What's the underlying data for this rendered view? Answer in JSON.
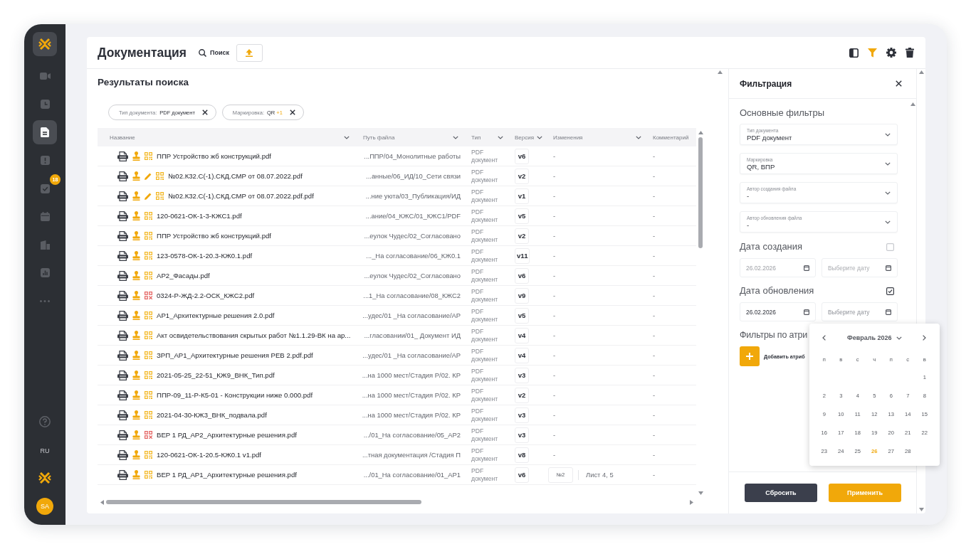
{
  "sidebar": {
    "nav": [
      {
        "selected": false
      },
      {
        "selected": false
      },
      {
        "selected": true
      },
      {
        "selected": false
      },
      {
        "selected": false,
        "badge": "18"
      },
      {
        "selected": false
      },
      {
        "selected": false
      },
      {
        "selected": false
      },
      {
        "selected": false
      }
    ],
    "language": "RU",
    "avatar": "SA"
  },
  "header": {
    "title": "Документация",
    "search_label": "Поиск",
    "toolbar": [
      {
        "active": false
      },
      {
        "active": true
      },
      {
        "active": false
      },
      {
        "active": false
      }
    ]
  },
  "results": {
    "title": "Результаты поиска",
    "chips": [
      {
        "label": "Тип документа:",
        "value": "PDF документ"
      },
      {
        "label": "Маркировка:",
        "value": "QR",
        "extra": "+1"
      }
    ]
  },
  "table": {
    "columns": [
      {
        "label": "Название",
        "menu": true
      },
      {
        "label": "Путь файла",
        "menu": true
      },
      {
        "label": "Тип",
        "menu": true
      },
      {
        "label": "Версия",
        "menu": true
      },
      {
        "label": "Изменения",
        "menu": true
      },
      {
        "label": "Комментарий",
        "menu": false
      }
    ],
    "rows": [
      {
        "name": "ППР Устройство жб конструкций.pdf",
        "edited": false,
        "qr_valid": true,
        "path": "...ППР/04_Монолитные работы",
        "type": "PDF документ",
        "version": "v6",
        "changes": {
          "text": "-"
        },
        "comment": "-"
      },
      {
        "name": "№02.К32.С(-1).СКД.СМР от 08.07.2022.pdf",
        "edited": true,
        "qr_valid": true,
        "path": "...анные/06_ИД/10_Сети связи",
        "type": "PDF документ",
        "version": "v2",
        "changes": {
          "text": "-"
        },
        "comment": "-"
      },
      {
        "name": "№02.К32.С(-1).СКД.СМР от 08.07.2022.pdf.pdf",
        "edited": true,
        "qr_valid": true,
        "path": "...ние уюта/03_Публикация/ИД",
        "type": "PDF документ",
        "version": "v1",
        "changes": {
          "text": "-"
        },
        "comment": "-"
      },
      {
        "name": "120-0621-ОК-1-3-КЖС1.pdf",
        "edited": false,
        "qr_valid": true,
        "path": "...ание/04_КЖС/01_КЖС1/PDF",
        "type": "PDF документ",
        "version": "v5",
        "changes": {
          "text": "-"
        },
        "comment": "-"
      },
      {
        "name": "ППР Устройство жб конструкций.pdf",
        "edited": false,
        "qr_valid": true,
        "path": "...еулок Чудес/02_Согласовано",
        "type": "PDF документ",
        "version": "v2",
        "changes": {
          "text": "-"
        },
        "comment": "-"
      },
      {
        "name": "123-0578-ОК-1-20.3-КЖ0.1.pdf",
        "edited": false,
        "qr_valid": true,
        "path": "..._На согласование/06_КЖ0.1",
        "type": "PDF документ",
        "version": "v11",
        "changes": {
          "text": "-"
        },
        "comment": "-"
      },
      {
        "name": "АР2_Фасады.pdf",
        "edited": false,
        "qr_valid": true,
        "path": "...еулок Чудес/02_Согласовано",
        "type": "PDF документ",
        "version": "v6",
        "changes": {
          "text": "-"
        },
        "comment": "-"
      },
      {
        "name": "0324-Р-ЖД-2.2-ОСК_КЖС2.pdf",
        "edited": false,
        "qr_valid": false,
        "path": "...1_На согласование/08_КЖС2",
        "type": "PDF документ",
        "version": "v9",
        "changes": {
          "text": "-"
        },
        "comment": "-"
      },
      {
        "name": "АР1_Архитектурные решения 2.0.pdf",
        "edited": false,
        "qr_valid": true,
        "path": "...удес/01 _На согласование/АР",
        "type": "PDF документ",
        "version": "v5",
        "changes": {
          "text": "-"
        },
        "comment": "-"
      },
      {
        "name": "Акт освидетельствования скрытых работ №1.1.29-ВК на ар...",
        "edited": false,
        "qr_valid": true,
        "path": "...гласовании/01_ Документ ИД",
        "type": "PDF документ",
        "version": "v4",
        "changes": {
          "text": "-"
        },
        "comment": "-"
      },
      {
        "name": "ЗРП_АР1_Архитектурные решения РЕВ 2.pdf.pdf",
        "edited": false,
        "qr_valid": true,
        "path": "...удес/01 _На согласование/АР",
        "type": "PDF документ",
        "version": "v4",
        "changes": {
          "text": "-"
        },
        "comment": "-"
      },
      {
        "name": "2021-05-25_22-51_КЖ9_ВНК_Тип.pdf",
        "edited": false,
        "qr_valid": true,
        "path": "...на 1000 мест/Стадия Р/02. КР",
        "type": "PDF документ",
        "version": "v3",
        "changes": {
          "text": "-"
        },
        "comment": "-"
      },
      {
        "name": "ППР-09_11-Р-К5-01 - Конструкции ниже 0.000.pdf",
        "edited": false,
        "qr_valid": true,
        "path": "...на 1000 мест/Стадия Р/02. КР",
        "type": "PDF документ",
        "version": "v2",
        "changes": {
          "text": "-"
        },
        "comment": "-"
      },
      {
        "name": "2021-04-30-КЖ3_ВНК_подвала.pdf",
        "edited": false,
        "qr_valid": true,
        "path": "...на 1000 мест/Стадия Р/02. КР",
        "type": "PDF документ",
        "version": "v3",
        "changes": {
          "text": "-"
        },
        "comment": "-"
      },
      {
        "name": "ВЕР 1 РД_АР2_Архитектурные решения.pdf",
        "edited": false,
        "qr_valid": false,
        "path": ".../01_На согласование/05_АР2",
        "type": "PDF документ",
        "version": "v3",
        "changes": {
          "text": "-"
        },
        "comment": "-"
      },
      {
        "name": "120-0621-ОК-1-20.5-КЖ0.1 v1.pdf",
        "edited": false,
        "qr_valid": true,
        "path": "...тная документация /Стадия П",
        "type": "PDF документ",
        "version": "v8",
        "changes": {
          "text": "-"
        },
        "comment": "-"
      },
      {
        "name": "ВЕР 1 РД_АР1_Архитектурные решения.pdf",
        "edited": false,
        "qr_valid": true,
        "path": ".../01_На согласование/01_АР1",
        "type": "PDF документ",
        "version": "v6",
        "changes": {
          "number": "№2",
          "text": "Лист 4, 5"
        },
        "comment": "-"
      }
    ]
  },
  "filter_panel": {
    "title": "Фильтрация",
    "main_title": "Основные фильтры",
    "selects": [
      {
        "label": "Тип документа",
        "value": "PDF документ"
      },
      {
        "label": "Маркировка",
        "value": "QR, ВПР"
      },
      {
        "label": "Автор создания файла",
        "value": "-"
      },
      {
        "label": "Автор обновления файла",
        "value": "-"
      }
    ],
    "date_groups": [
      {
        "title": "Дата создания",
        "checked": false,
        "from": {
          "value": "26.02.2026"
        },
        "to": {
          "placeholder": "Выберите дату"
        }
      },
      {
        "title": "Дата обновления",
        "checked": true,
        "from": {
          "value": "26.02.2026"
        },
        "to": {
          "placeholder": "Выберите дату"
        }
      }
    ],
    "attributes_title": "Фильтры по атри",
    "add_label": "Добавить атриб",
    "date_picker": {
      "month": "Февраль 2026",
      "weekdays": [
        "п",
        "в",
        "с",
        "ч",
        "п",
        "с",
        "в"
      ],
      "weeks": [
        [
          {
            "day": "1",
            "selected": false
          }
        ],
        [
          {
            "day": "2",
            "selected": false
          },
          {
            "day": "3",
            "selected": false
          },
          {
            "day": "4",
            "selected": false
          },
          {
            "day": "5",
            "selected": false
          },
          {
            "day": "6",
            "selected": false
          },
          {
            "day": "7",
            "selected": false
          },
          {
            "day": "8",
            "selected": false
          }
        ],
        [
          {
            "day": "9",
            "selected": false
          },
          {
            "day": "10",
            "selected": false
          },
          {
            "day": "11",
            "selected": false
          },
          {
            "day": "12",
            "selected": false
          },
          {
            "day": "13",
            "selected": false
          },
          {
            "day": "14",
            "selected": false
          },
          {
            "day": "15",
            "selected": false
          }
        ],
        [
          {
            "day": "16",
            "selected": false
          },
          {
            "day": "17",
            "selected": false
          },
          {
            "day": "18",
            "selected": false
          },
          {
            "day": "19",
            "selected": false
          },
          {
            "day": "20",
            "selected": false
          },
          {
            "day": "21",
            "selected": false
          },
          {
            "day": "22",
            "selected": false
          }
        ],
        [
          {
            "day": "23",
            "selected": false
          },
          {
            "day": "24",
            "selected": false
          },
          {
            "day": "25",
            "selected": false
          },
          {
            "day": "26",
            "selected": true
          },
          {
            "day": "27",
            "selected": false
          },
          {
            "day": "28",
            "selected": false
          }
        ]
      ]
    },
    "buttons": [
      {
        "label": "Сбросить",
        "kind": "secondary"
      },
      {
        "label": "Применить",
        "kind": "primary"
      }
    ]
  }
}
